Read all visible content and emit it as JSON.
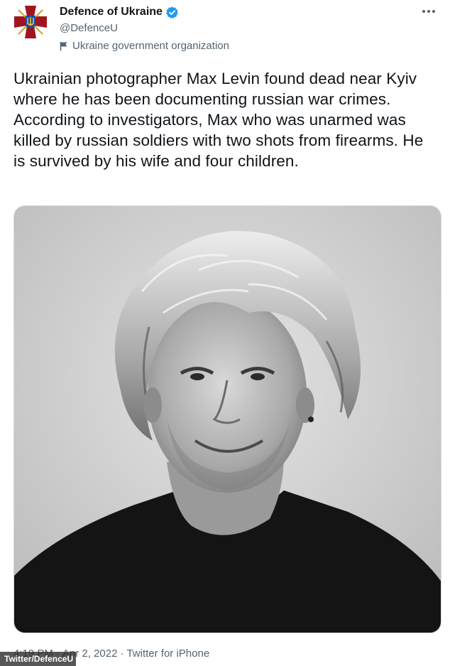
{
  "account": {
    "display_name": "Defence of Ukraine",
    "handle": "@DefenceU",
    "affiliation": "Ukraine government organization",
    "verified": true
  },
  "tweet": {
    "text": "Ukrainian photographer Max Levin found dead near Kyiv where he has been documenting russian war crimes. According to investigators, Max who was unarmed was killed by russian soldiers with two shots from firearms. He is survived by his wife and four children.",
    "time": "4:19 PM",
    "separator_1": "·",
    "date": "Apr 2, 2022",
    "separator_2": "·",
    "source": "Twitter for iPhone"
  },
  "photo_credit": "Twitter/DefenceU",
  "colors": {
    "verified_blue": "#1d9bf0",
    "secondary_text": "#536471",
    "avatar_red": "#a0151f"
  },
  "icons": {
    "avatar": "defence-ministry-emblem",
    "verified": "verified-badge-icon",
    "affiliation": "flag-icon",
    "menu": "more-dots-icon"
  }
}
